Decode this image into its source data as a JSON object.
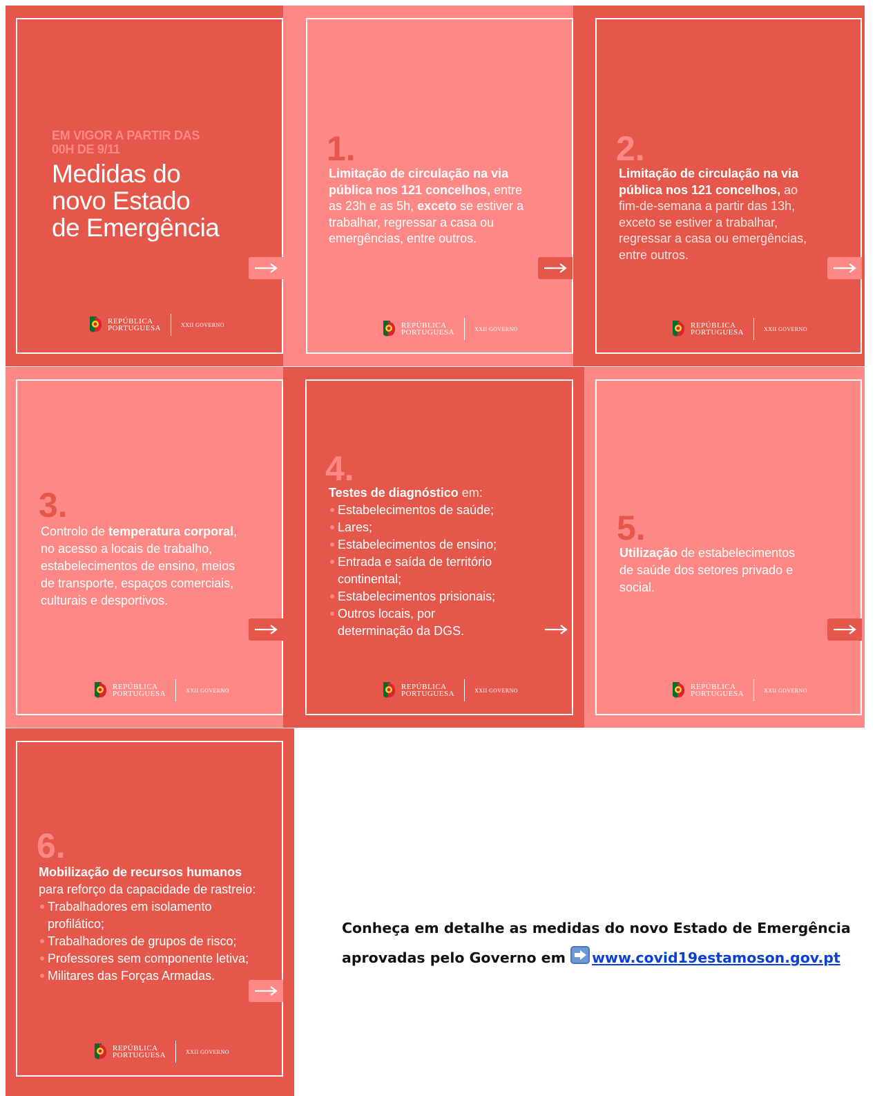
{
  "cover": {
    "subtitle_line1": "EM VIGOR A PARTIR DAS",
    "subtitle_line2": "00H DE 9/11",
    "title_line1": "Medidas do",
    "title_line2": "novo Estado",
    "title_line3": "de Emergência"
  },
  "logo": {
    "line1": "REPÚBLICA",
    "line2": "PORTUGUESA",
    "government": "XXII GOVERNO"
  },
  "measures": [
    {
      "number": "1.",
      "bold1": "Limitação de circulação na via pública nos 121 concelhos,",
      "text1": " entre as 23h e as 5h, ",
      "bold2": "exceto",
      "text2": " se estiver a trabalhar, regressar a casa ou emergências, entre outros."
    },
    {
      "number": "2.",
      "bold1": "Limitação de circulação na via pública nos 121 concelhos,",
      "text1": " ao fim-de-semana a partir das 13h, exceto se estiver a trabalhar, regressar a casa ou emergências, entre outros."
    },
    {
      "number": "3.",
      "text1": "Controlo de ",
      "bold1": "temperatura corporal",
      "text2": ", no acesso a locais de trabalho, estabelecimentos de ensino, meios de transporte, espaços comerciais, culturais e desportivos."
    },
    {
      "number": "4.",
      "bold1": "Testes de diagnóstico",
      "text1": " em:",
      "items": [
        "Estabelecimentos de saúde;",
        "Lares;",
        "Estabelecimentos de ensino;",
        "Entrada e saída de território continental;",
        "Estabelecimentos prisionais;",
        "Outros locais, por determinação da DGS."
      ]
    },
    {
      "number": "5.",
      "bold1": "Utilização",
      "text1": " de estabelecimentos de saúde dos setores privado e social."
    },
    {
      "number": "6.",
      "bold1": "Mobilização de recursos humanos",
      "text1": "para reforço da capacidade de rastreio:",
      "items": [
        "Trabalhadores em isolamento profilático;",
        "Trabalhadores de grupos de risco;",
        "Professores sem componente letiva;",
        "Militares das Forças Armadas."
      ]
    }
  ],
  "caption": {
    "line1": "Conheça em detalhe as medidas do novo Estado de Emergência",
    "line2_prefix": "aprovadas pelo Governo em ",
    "link_text": "www.covid19estamoson.gov.pt",
    "icon": "right-arrow-icon"
  },
  "colors": {
    "dark_red": "#e5574a",
    "light_red": "#fe8886",
    "link": "#0b3fd1"
  }
}
